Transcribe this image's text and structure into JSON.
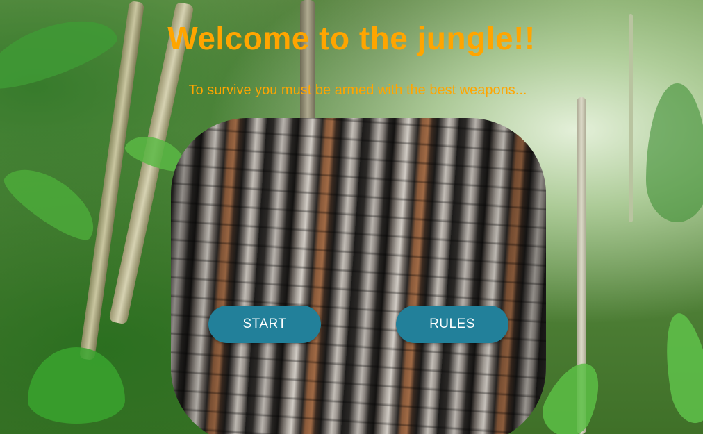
{
  "page": {
    "title": "Welcome to the jungle!!",
    "subtitle": "To survive you must be armed with the best weapons..."
  },
  "menu": {
    "start_label": "START",
    "rules_label": "RULES"
  },
  "colors": {
    "title": "#ffa500",
    "button_bg": "#22809a",
    "button_text": "#ffffff"
  }
}
